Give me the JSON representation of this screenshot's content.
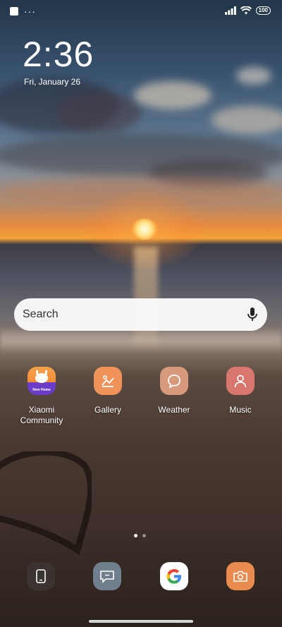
{
  "status_bar": {
    "battery": "100",
    "overflow_glyph": "···"
  },
  "lockclock": {
    "time": "2:36",
    "date": "Fri, January 26"
  },
  "search": {
    "placeholder": "Search",
    "mic_icon": "microphone-icon"
  },
  "apps": [
    {
      "label": "Xiaomi\nCommunity",
      "icon": "mi-community-icon",
      "badge": "New Home",
      "color": "#f28b37"
    },
    {
      "label": "Gallery",
      "icon": "gallery-icon",
      "color": "#f0935a"
    },
    {
      "label": "Weather",
      "icon": "weather-chat-icon",
      "color": "#d89a7c"
    },
    {
      "label": "Music",
      "icon": "music-person-icon",
      "color": "#d9776e"
    }
  ],
  "pagination": {
    "pages": 2,
    "active": 1
  },
  "dock": [
    {
      "name": "phone-icon",
      "color": "#3a332f"
    },
    {
      "name": "messages-icon",
      "color": "#6f7f8d"
    },
    {
      "name": "google-icon",
      "color": "#ffffff"
    },
    {
      "name": "camera-icon",
      "color": "#e98a4e"
    }
  ]
}
